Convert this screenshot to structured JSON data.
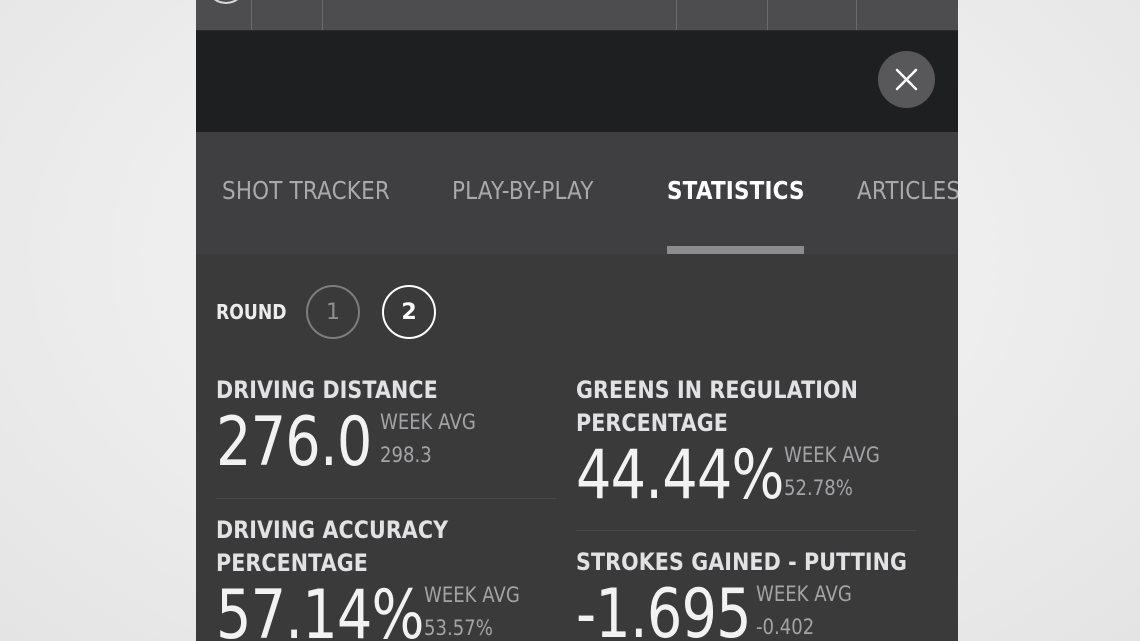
{
  "close_icon_name": "close-icon",
  "tabs": [
    {
      "label": "SHOT TRACKER",
      "active": false
    },
    {
      "label": "PLAY-BY-PLAY",
      "active": false
    },
    {
      "label": "STATISTICS",
      "active": true
    },
    {
      "label": "ARTICLES",
      "active": false
    }
  ],
  "round": {
    "label": "ROUND",
    "options": [
      "1",
      "2"
    ],
    "selected": "2"
  },
  "stats": [
    {
      "label_line1": "DRIVING DISTANCE",
      "label_line2": "",
      "value": "276.0",
      "avg_label": "WEEK AVG",
      "avg_value": "298.3"
    },
    {
      "label_line1": "GREENS IN REGULATION",
      "label_line2": "PERCENTAGE",
      "value": "44.44%",
      "avg_label": "WEEK AVG",
      "avg_value": "52.78%"
    },
    {
      "label_line1": "DRIVING ACCURACY",
      "label_line2": "PERCENTAGE",
      "value": "57.14%",
      "avg_label": "WEEK AVG",
      "avg_value": "53.57%"
    },
    {
      "label_line1": "STROKES GAINED - PUTTING",
      "label_line2": "",
      "value": "-1.695",
      "avg_label": "WEEK AVG",
      "avg_value": "-0.402"
    }
  ],
  "colors": {
    "panel_bg": "#3a3a3b",
    "header_bar": "#1e1f20",
    "tab_active": "#ffffff",
    "tab_inactive": "#a9a9ab"
  }
}
